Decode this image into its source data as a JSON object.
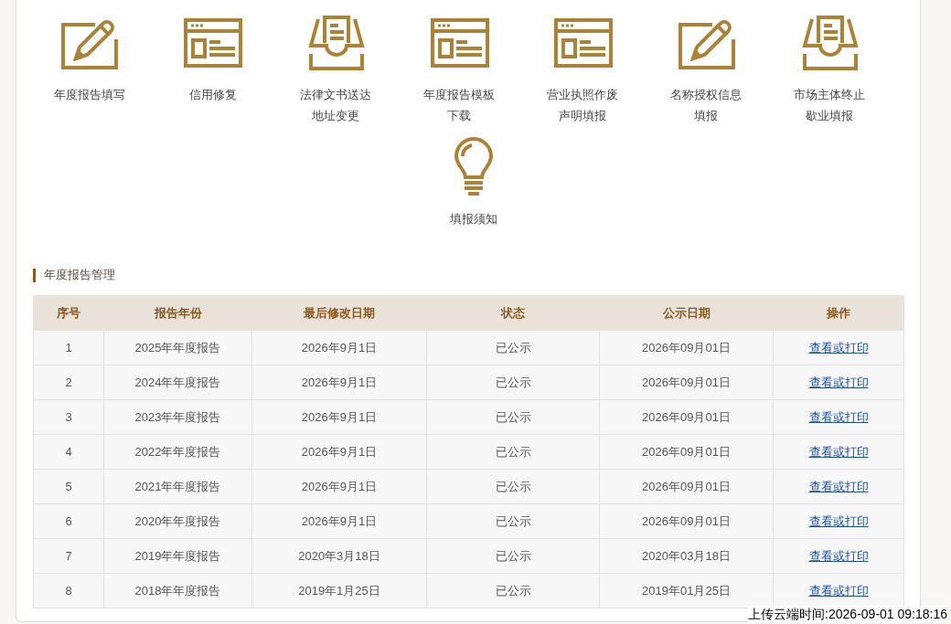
{
  "services": [
    {
      "kind": "pencil",
      "label": "年度报告填写"
    },
    {
      "kind": "window",
      "label": "信用修复"
    },
    {
      "kind": "tray",
      "label": "法律文书送达地址变更"
    },
    {
      "kind": "window",
      "label": "年度报告模板下载"
    },
    {
      "kind": "window",
      "label": "营业执照作废声明填报"
    },
    {
      "kind": "pencil",
      "label": "名称授权信息填报"
    },
    {
      "kind": "tray",
      "label": "市场主体终止歇业填报"
    },
    {
      "kind": "bulb",
      "label": "填报须知"
    }
  ],
  "section": {
    "title": "年度报告管理"
  },
  "table": {
    "columns": [
      "序号",
      "报告年份",
      "最后修改日期",
      "状态",
      "公示日期",
      "操作"
    ],
    "rows": [
      {
        "no": "1",
        "report": "2025年年度报告",
        "modified": "2026年9月1日",
        "status": "已公示",
        "published": "2026年09月01日",
        "action": "查看或打印"
      },
      {
        "no": "2",
        "report": "2024年年度报告",
        "modified": "2026年9月1日",
        "status": "已公示",
        "published": "2026年09月01日",
        "action": "查看或打印"
      },
      {
        "no": "3",
        "report": "2023年年度报告",
        "modified": "2026年9月1日",
        "status": "已公示",
        "published": "2026年09月01日",
        "action": "查看或打印"
      },
      {
        "no": "4",
        "report": "2022年年度报告",
        "modified": "2026年9月1日",
        "status": "已公示",
        "published": "2026年09月01日",
        "action": "查看或打印"
      },
      {
        "no": "5",
        "report": "2021年年度报告",
        "modified": "2026年9月1日",
        "status": "已公示",
        "published": "2026年09月01日",
        "action": "查看或打印"
      },
      {
        "no": "6",
        "report": "2020年年度报告",
        "modified": "2026年9月1日",
        "status": "已公示",
        "published": "2026年09月01日",
        "action": "查看或打印"
      },
      {
        "no": "7",
        "report": "2019年年度报告",
        "modified": "2020年3月18日",
        "status": "已公示",
        "published": "2020年03月18日",
        "action": "查看或打印"
      },
      {
        "no": "8",
        "report": "2018年年度报告",
        "modified": "2019年1月25日",
        "status": "已公示",
        "published": "2019年01月25日",
        "action": "查看或打印"
      }
    ]
  },
  "upload_timestamp": "上传云端时间:2026-09-01 09:18:16"
}
